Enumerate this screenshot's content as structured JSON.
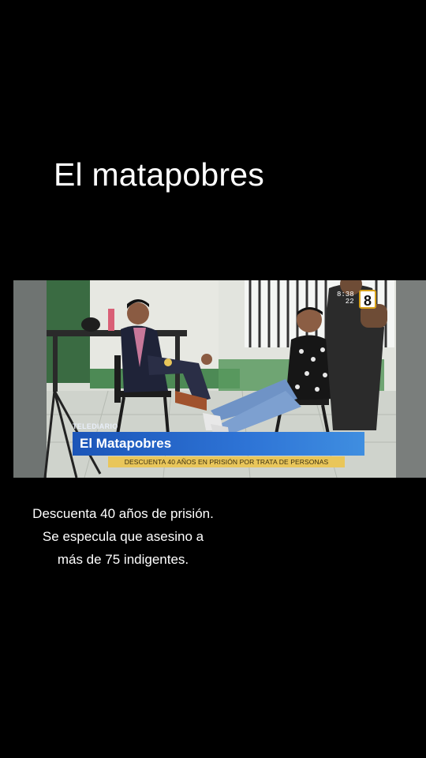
{
  "title": "El matapobres",
  "video": {
    "logo": "TELEDIARIO",
    "headline": "El Matapobres",
    "subheadline": "DESCUENTA 40 AÑOS EN PRISIÓN POR TRATA DE PERSONAS",
    "clock_time": "8:38",
    "clock_temp": "22",
    "channel": "8"
  },
  "caption": "Descuenta 40 años de prisión. Se especula que asesino a más de 75 indigentes.",
  "colors": {
    "background": "#000000",
    "lower_third_blue": "#2563c9",
    "lower_third_yellow": "#e9c65a"
  }
}
